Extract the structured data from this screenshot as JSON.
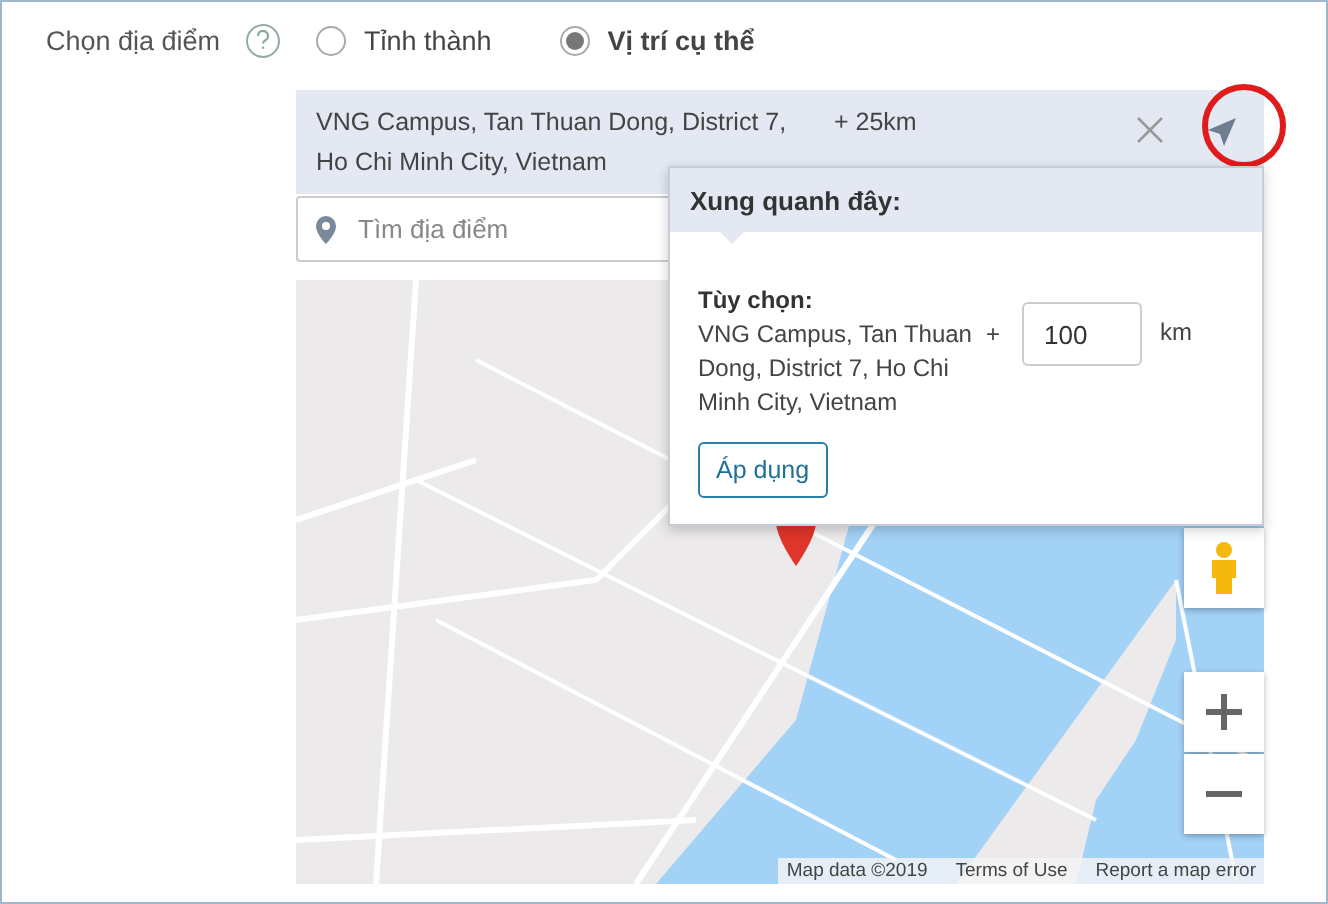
{
  "field": {
    "label": "Chọn địa điểm"
  },
  "options": [
    {
      "label": "Tỉnh thành",
      "selected": false
    },
    {
      "label": "Vị trí cụ thể",
      "selected": true
    }
  ],
  "selected_location": {
    "address": "VNG Campus, Tan Thuan Dong, District 7, Ho Chi Minh City, Vietnam",
    "radius": "+ 25km",
    "annotated": true
  },
  "search": {
    "placeholder": "Tìm địa điểm"
  },
  "popup": {
    "title": "Xung quanh đây:",
    "option_label": "Tùy chọn:",
    "address": "VNG Campus, Tan Thuan Dong, District 7, Ho Chi Minh City, Vietnam",
    "plus": "+",
    "radius_value": "100",
    "unit": "km",
    "apply_button": "Áp dụng"
  },
  "map": {
    "attribution": [
      "Map data ©2019",
      "Terms of Use",
      "Report a map error"
    ]
  }
}
